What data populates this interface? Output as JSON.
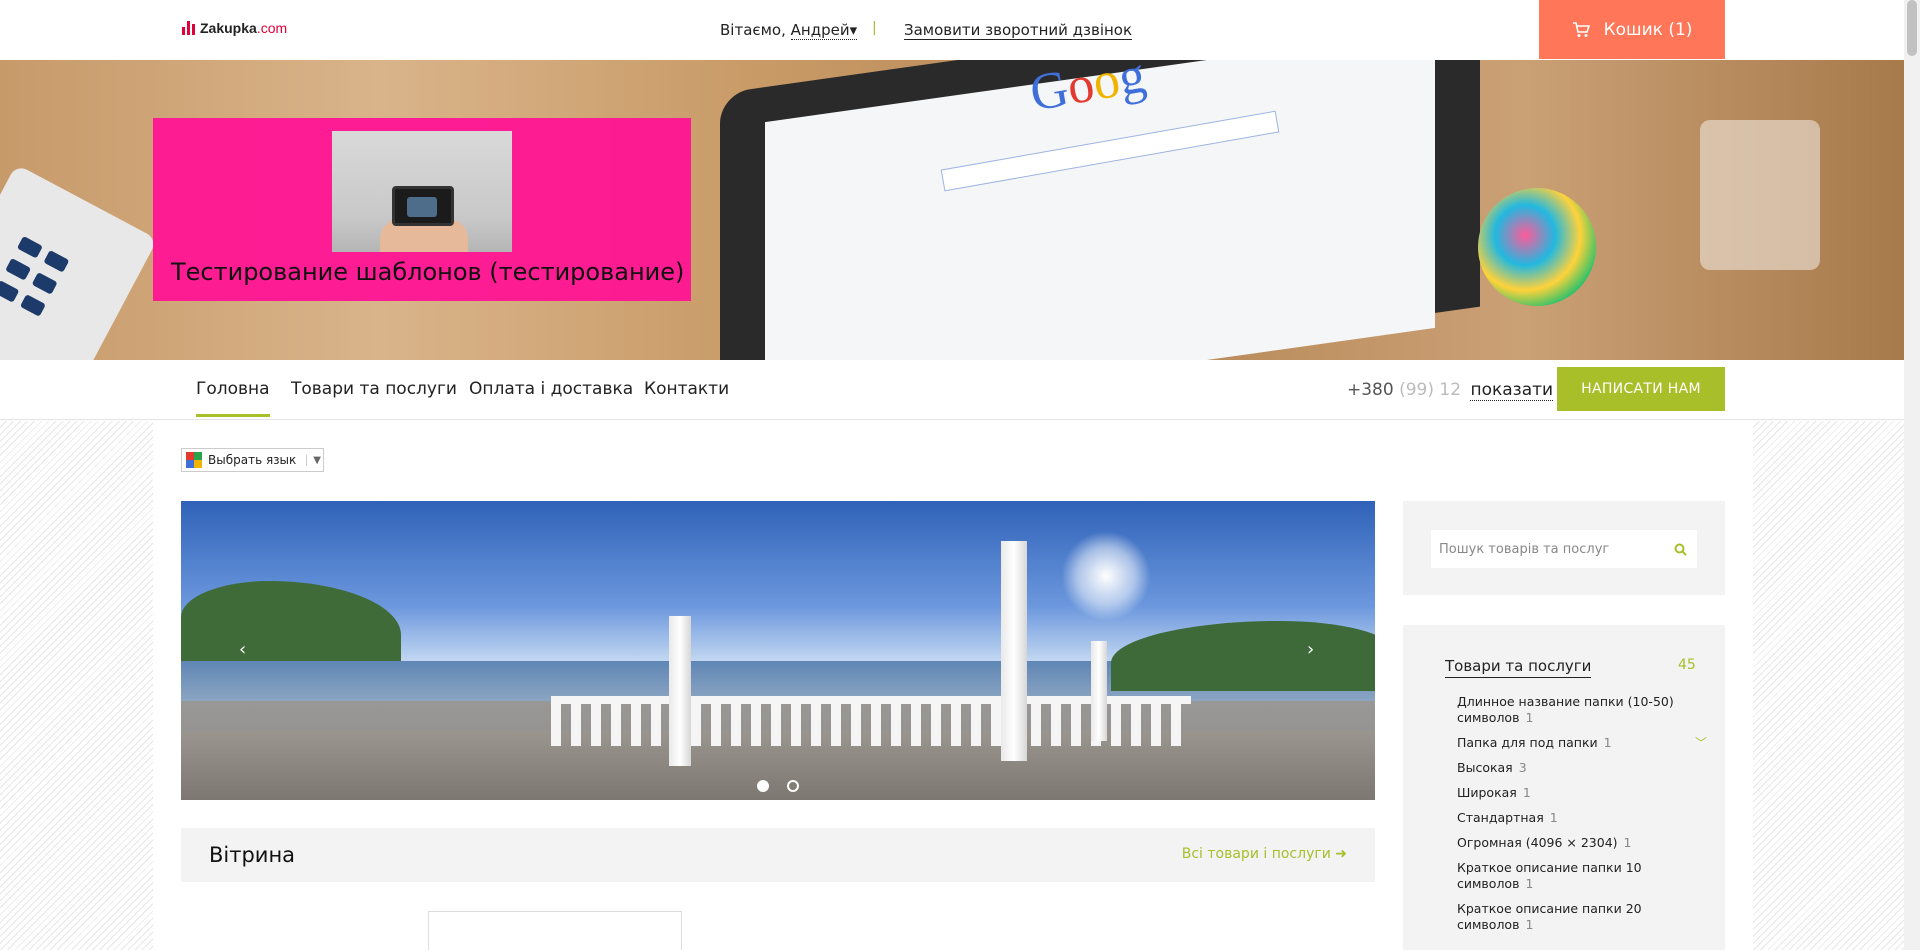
{
  "header": {
    "logo_name": "Zakupka",
    "logo_domain": ".com",
    "greeting": "Вітаємо,",
    "user_name": "Андрей",
    "user_caret": "▾",
    "separator": "|",
    "callback": "Замовити зворотний дзвінок",
    "cart_label": "Кошик (1)",
    "cart_icon": "cart-icon",
    "accent_color": "#ff7659"
  },
  "hero": {
    "company_title": "Тестирование шаблонов (тестирование)",
    "google_text": "Google",
    "brand_box_color": "#ff1493"
  },
  "nav": {
    "items": [
      {
        "label": "Головна",
        "active": true
      },
      {
        "label": "Товари та послуги"
      },
      {
        "label": "Оплата і доставка"
      },
      {
        "label": "Контакти"
      }
    ],
    "phone_visible": "+380",
    "phone_hidden": " (99) 12",
    "phone_show": "показати",
    "write_us": "НАПИСАТИ НАМ",
    "accent_color": "#a8bf2a"
  },
  "lang": {
    "label": "Выбрать язык",
    "arrow": "▼"
  },
  "slider": {
    "prev": "‹",
    "next": "›",
    "dots": 2,
    "active_dot": 1
  },
  "vitrina": {
    "title": "Вітрина",
    "all_link": "Всі товари і послуги ➜"
  },
  "sidebar": {
    "search_placeholder": "Пошук товарів та послуг",
    "search_icon": "search-icon",
    "category_title": "Товари та послуги",
    "category_count": "45",
    "items": [
      {
        "label": "Длинное название папки (10-50) символов",
        "count": "1"
      },
      {
        "label": "Папка для под папки",
        "count": "1",
        "expandable": true
      },
      {
        "label": "Высокая",
        "count": "3"
      },
      {
        "label": "Широкая",
        "count": "1"
      },
      {
        "label": "Стандартная",
        "count": "1"
      },
      {
        "label": "Огромная (4096 × 2304)",
        "count": "1"
      },
      {
        "label": "Краткое описание папки 10 символов",
        "count": "1"
      },
      {
        "label": "Краткое описание папки 20 символов",
        "count": "1"
      }
    ]
  }
}
